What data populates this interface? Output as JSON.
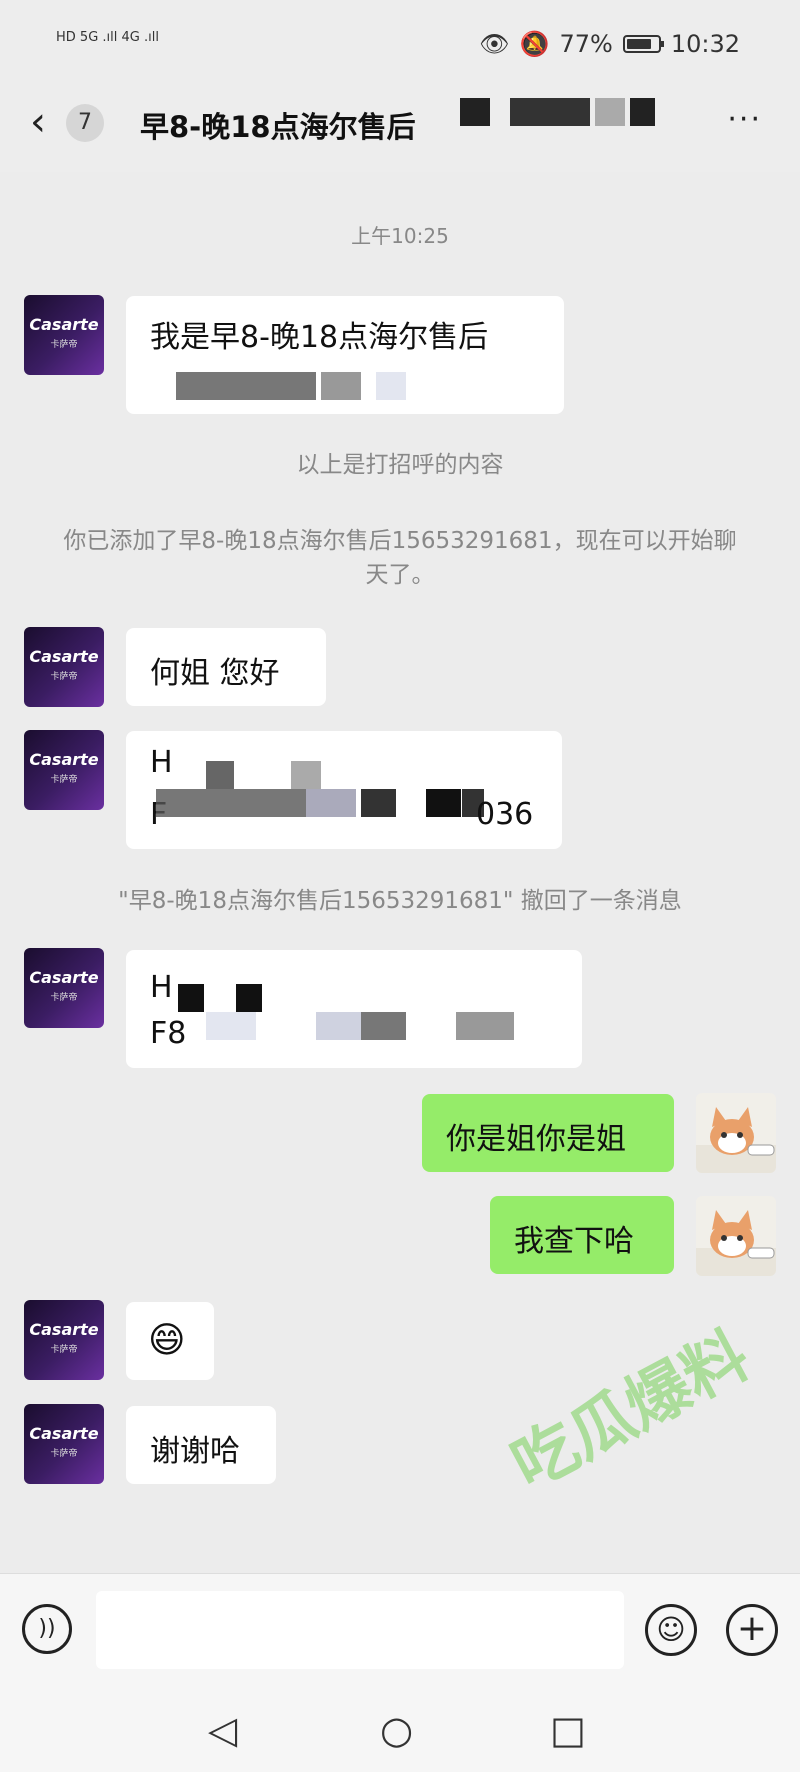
{
  "status_bar": {
    "left_indicators": "HD 5G .ıll 4G .ıll",
    "battery": "77%",
    "time": "10:32"
  },
  "header": {
    "back_icon": "chevron-left-icon",
    "unread_count": "7",
    "title": "早8-晚18点海尔售后",
    "more_label": "···"
  },
  "chat": {
    "timestamp": "上午10:25",
    "greeting_msg": "我是早8-晚18点海尔售后",
    "greeting_note": "以上是打招呼的内容",
    "added_notice": "你已添加了早8-晚18点海尔售后15653291681，现在可以开始聊天了。",
    "msg_hello": "何姐 您好",
    "msg_serial_line1": "H",
    "msg_serial_line2": "F",
    "msg_serial_suffix": "036",
    "recall_notice": "\"早8-晚18点海尔售后15653291681\" 撤回了一条消息",
    "msg_serial2_line1": "H",
    "msg_serial2_line2": "F8",
    "my_msg_1": "你是姐你是姐",
    "my_msg_2": "我查下哈",
    "msg_emoji": "😄",
    "msg_thanks": "谢谢哈"
  },
  "avatar": {
    "brand": "Casarte",
    "brand_sub": "卡萨帝"
  },
  "watermark": "吃瓜爆料"
}
